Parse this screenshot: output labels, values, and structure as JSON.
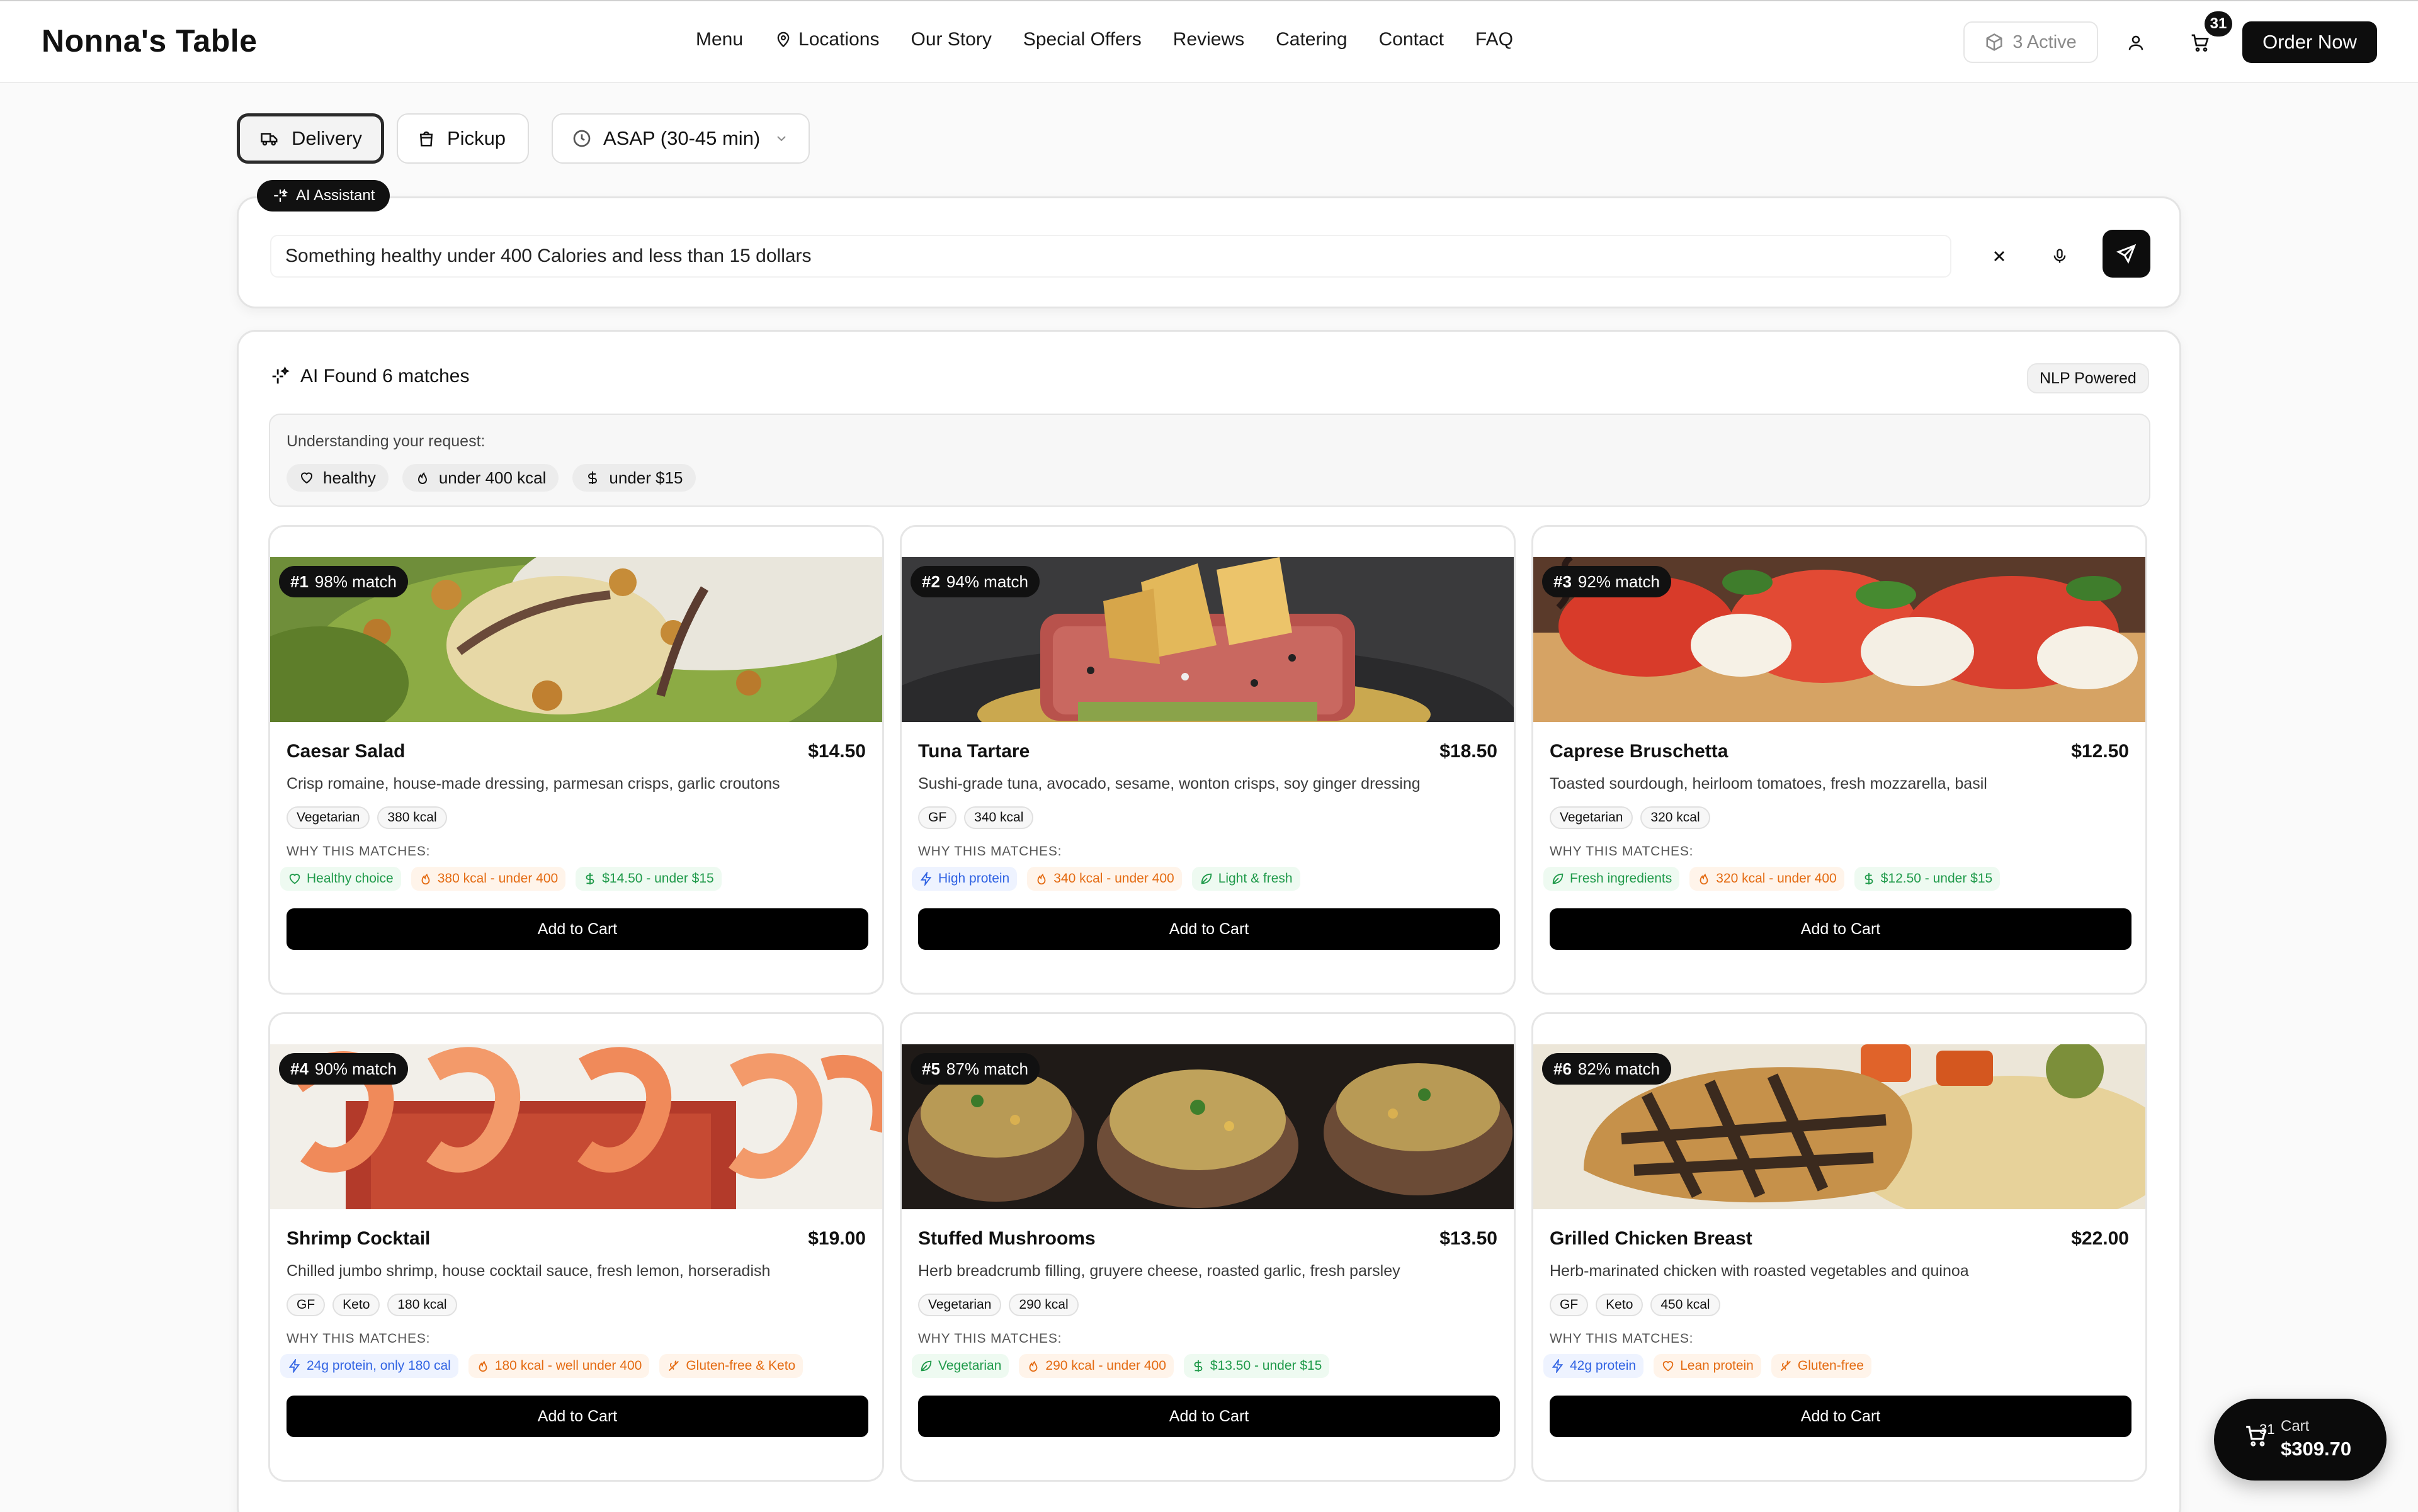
{
  "header": {
    "brand": "Nonna's Table",
    "nav": [
      "Menu",
      "Locations",
      "Our Story",
      "Special Offers",
      "Reviews",
      "Catering",
      "Contact",
      "FAQ"
    ],
    "active_label": "3 Active",
    "cart_count": "31",
    "order_now": "Order Now"
  },
  "modes": {
    "delivery": "Delivery",
    "pickup": "Pickup",
    "time": "ASAP (30-45 min)"
  },
  "ai": {
    "tag": "AI Assistant",
    "query": "Something healthy under 400 Calories and less than 15 dollars"
  },
  "results": {
    "title": "AI Found 6 matches",
    "badge": "NLP Powered",
    "understanding_label": "Understanding your request:",
    "chips": [
      "healthy",
      "under 400 kcal",
      "under $15"
    ],
    "why_label": "WHY THIS MATCHES:",
    "add_label": "Add to Cart",
    "items": [
      {
        "rank": "#1",
        "match": "98% match",
        "name": "Caesar Salad",
        "price": "$14.50",
        "desc": "Crisp romaine, house-made dressing, parmesan crisps, garlic croutons",
        "tags": [
          "Vegetarian",
          "380 kcal"
        ],
        "reasons": [
          {
            "text": "Healthy choice",
            "color": "green",
            "icon": "heart-icon"
          },
          {
            "text": "380 kcal - under 400",
            "color": "orange",
            "icon": "flame-icon"
          },
          {
            "text": "$14.50 - under $15",
            "color": "green",
            "icon": "dollar-icon"
          }
        ]
      },
      {
        "rank": "#2",
        "match": "94% match",
        "name": "Tuna Tartare",
        "price": "$18.50",
        "desc": "Sushi-grade tuna, avocado, sesame, wonton crisps, soy ginger dressing",
        "tags": [
          "GF",
          "340 kcal"
        ],
        "reasons": [
          {
            "text": "High protein",
            "color": "blue",
            "icon": "bolt-icon"
          },
          {
            "text": "340 kcal - under 400",
            "color": "orange",
            "icon": "flame-icon"
          },
          {
            "text": "Light & fresh",
            "color": "green",
            "icon": "leaf-icon"
          }
        ]
      },
      {
        "rank": "#3",
        "match": "92% match",
        "name": "Caprese Bruschetta",
        "price": "$12.50",
        "desc": "Toasted sourdough, heirloom tomatoes, fresh mozzarella, basil",
        "tags": [
          "Vegetarian",
          "320 kcal"
        ],
        "reasons": [
          {
            "text": "Fresh ingredients",
            "color": "green",
            "icon": "leaf-icon"
          },
          {
            "text": "320 kcal - under 400",
            "color": "orange",
            "icon": "flame-icon"
          },
          {
            "text": "$12.50 - under $15",
            "color": "green",
            "icon": "dollar-icon"
          }
        ]
      },
      {
        "rank": "#4",
        "match": "90% match",
        "name": "Shrimp Cocktail",
        "price": "$19.00",
        "desc": "Chilled jumbo shrimp, house cocktail sauce, fresh lemon, horseradish",
        "tags": [
          "GF",
          "Keto",
          "180 kcal"
        ],
        "reasons": [
          {
            "text": "24g protein, only 180 cal",
            "color": "blue",
            "icon": "bolt-icon"
          },
          {
            "text": "180 kcal - well under 400",
            "color": "orange",
            "icon": "flame-icon"
          },
          {
            "text": "Gluten-free & Keto",
            "color": "orange",
            "icon": "wheat-off-icon"
          }
        ]
      },
      {
        "rank": "#5",
        "match": "87% match",
        "name": "Stuffed Mushrooms",
        "price": "$13.50",
        "desc": "Herb breadcrumb filling, gruyere cheese, roasted garlic, fresh parsley",
        "tags": [
          "Vegetarian",
          "290 kcal"
        ],
        "reasons": [
          {
            "text": "Vegetarian",
            "color": "green",
            "icon": "leaf-icon"
          },
          {
            "text": "290 kcal - under 400",
            "color": "orange",
            "icon": "flame-icon"
          },
          {
            "text": "$13.50 - under $15",
            "color": "green",
            "icon": "dollar-icon"
          }
        ]
      },
      {
        "rank": "#6",
        "match": "82% match",
        "name": "Grilled Chicken Breast",
        "price": "$22.00",
        "desc": "Herb-marinated chicken with roasted vegetables and quinoa",
        "tags": [
          "GF",
          "Keto",
          "450 kcal"
        ],
        "reasons": [
          {
            "text": "42g protein",
            "color": "blue",
            "icon": "bolt-icon"
          },
          {
            "text": "Lean protein",
            "color": "orange",
            "icon": "heart-icon"
          },
          {
            "text": "Gluten-free",
            "color": "orange",
            "icon": "wheat-off-icon"
          }
        ]
      }
    ]
  },
  "floating_cart": {
    "count": "31",
    "label": "Cart",
    "total": "$309.70"
  },
  "colors": {
    "green": "#1f9a4a",
    "orange": "#e46b12",
    "blue": "#2f62e3",
    "primary": "#0d0d0d"
  }
}
